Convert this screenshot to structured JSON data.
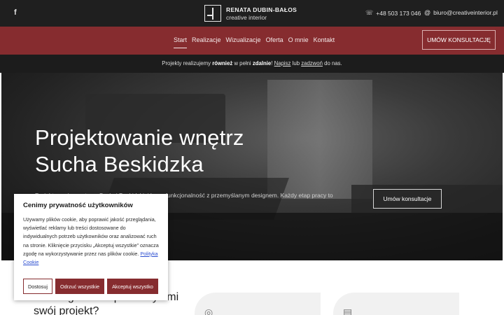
{
  "topbar": {
    "facebook_icon": "facebook-icon",
    "logo_name": "RENATA DUBIN-BAŁOS",
    "logo_tagline": "creative interior",
    "phone_icon": "phone-icon",
    "phone": "+48 503 173 046",
    "email_icon": "at-icon",
    "email": "biuro@creativeinterior.pl"
  },
  "nav": {
    "items": [
      {
        "label": "Start"
      },
      {
        "label": "Realizacje"
      },
      {
        "label": "Wizualizacje"
      },
      {
        "label": "Oferta"
      },
      {
        "label": "O mnie"
      },
      {
        "label": "Kontakt"
      }
    ],
    "cta": "UMÓW KONSULTACJĘ"
  },
  "strip": {
    "part1": "Projekty realizujemy ",
    "bold1": "również",
    "part2": " w pełni ",
    "bold2": "zdalnie",
    "part3": "! ",
    "link1": "Napisz",
    "part4": " lub ",
    "link2": "zadzwoń",
    "part5": " do nas."
  },
  "hero": {
    "title_line1": "Projektowanie wnętrz",
    "title_line2": "Sucha Beskidzka",
    "text": "Projektowanie wnętrz w Suchej Beskidzkiej łączy funkcjonalność z przemyślanym designem. Każdy etap pracy to świadoma decyzja.",
    "button": "Umów konsultacje"
  },
  "section": {
    "title": "Dlaczego warto powierzyć mi swój projekt?"
  },
  "cookie": {
    "title": "Cenimy prywatność użytkowników",
    "text": "Używamy plików cookie, aby poprawić jakość przeglądania, wyświetlać reklamy lub treści dostosowane do indywidualnych potrzeb użytkowników oraz analizować ruch na stronie. Kliknięcie przycisku „Akceptuj wszystkie” oznacza zgodę na wykorzystywanie przez nas plików cookie.",
    "link": "Polityka Cookie",
    "btn_customize": "Dostosuj",
    "btn_reject": "Odrzuć wszystkie",
    "btn_accept": "Akceptuj wszystko"
  },
  "colors": {
    "brand": "#862c2f",
    "dark": "#1f1f1f"
  }
}
